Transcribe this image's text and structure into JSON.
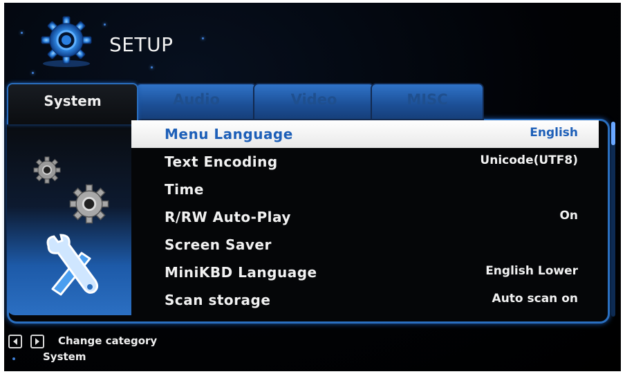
{
  "header": {
    "title": "SETUP",
    "icon": "gear-icon"
  },
  "tabs": [
    {
      "label": "System",
      "active": true
    },
    {
      "label": "Audio",
      "active": false
    },
    {
      "label": "Video",
      "active": false
    },
    {
      "label": "MISC",
      "active": false
    }
  ],
  "menu": [
    {
      "label": "Menu Language",
      "value": "English",
      "selected": true
    },
    {
      "label": "Text Encoding",
      "value": "Unicode(UTF8)",
      "selected": false
    },
    {
      "label": "Time",
      "value": "",
      "selected": false
    },
    {
      "label": "R/RW Auto-Play",
      "value": "On",
      "selected": false
    },
    {
      "label": "Screen Saver",
      "value": "",
      "selected": false
    },
    {
      "label": "MiniKBD Language",
      "value": "English Lower",
      "selected": false
    },
    {
      "label": "Scan storage",
      "value": "Auto scan on",
      "selected": false
    }
  ],
  "footer": {
    "hint": "Change category",
    "category": "System",
    "keys": [
      "arrow-left-icon",
      "arrow-right-icon"
    ]
  },
  "colors": {
    "accent": "#2a6fc0",
    "highlight_text": "#1d5fb8",
    "background": "#000000"
  }
}
